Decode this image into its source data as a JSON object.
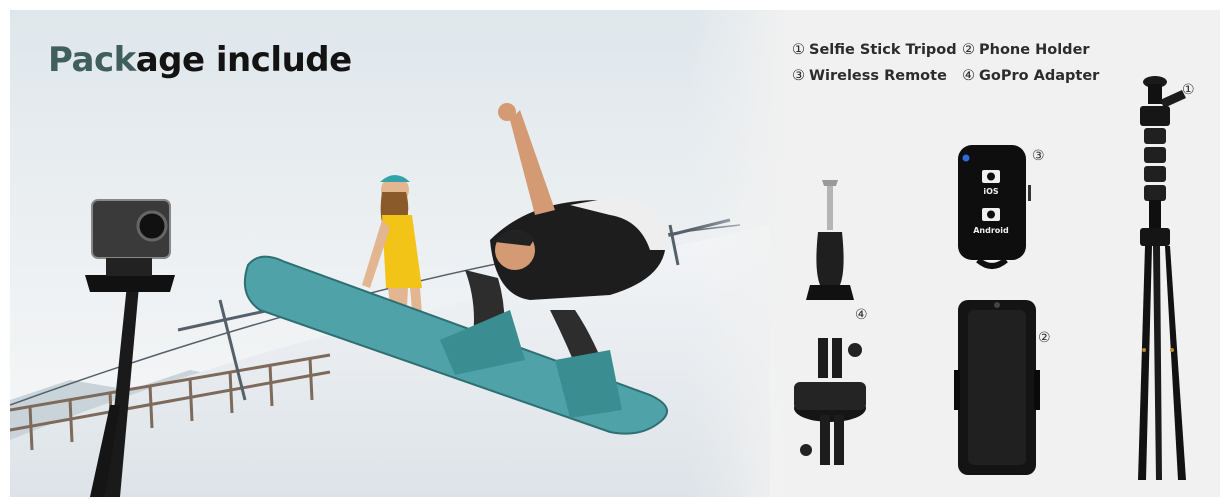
{
  "title": {
    "accent": "Pack",
    "rest": "age include"
  },
  "legend": [
    {
      "num": "①",
      "label": "Selfie Stick Tripod"
    },
    {
      "num": "②",
      "label": "Phone Holder"
    },
    {
      "num": "③",
      "label": "Wireless Remote"
    },
    {
      "num": "④",
      "label": "GoPro Adapter"
    }
  ],
  "callouts": {
    "tripod": "①",
    "holder": "②",
    "remote": "③",
    "adapter": "④"
  },
  "remote_buttons": {
    "top": "iOS",
    "bottom": "Android"
  },
  "colors": {
    "title_accent": "#3f5e5c",
    "snowboard": "#4fa3a8",
    "panel_bg": "#f1f1f1"
  }
}
